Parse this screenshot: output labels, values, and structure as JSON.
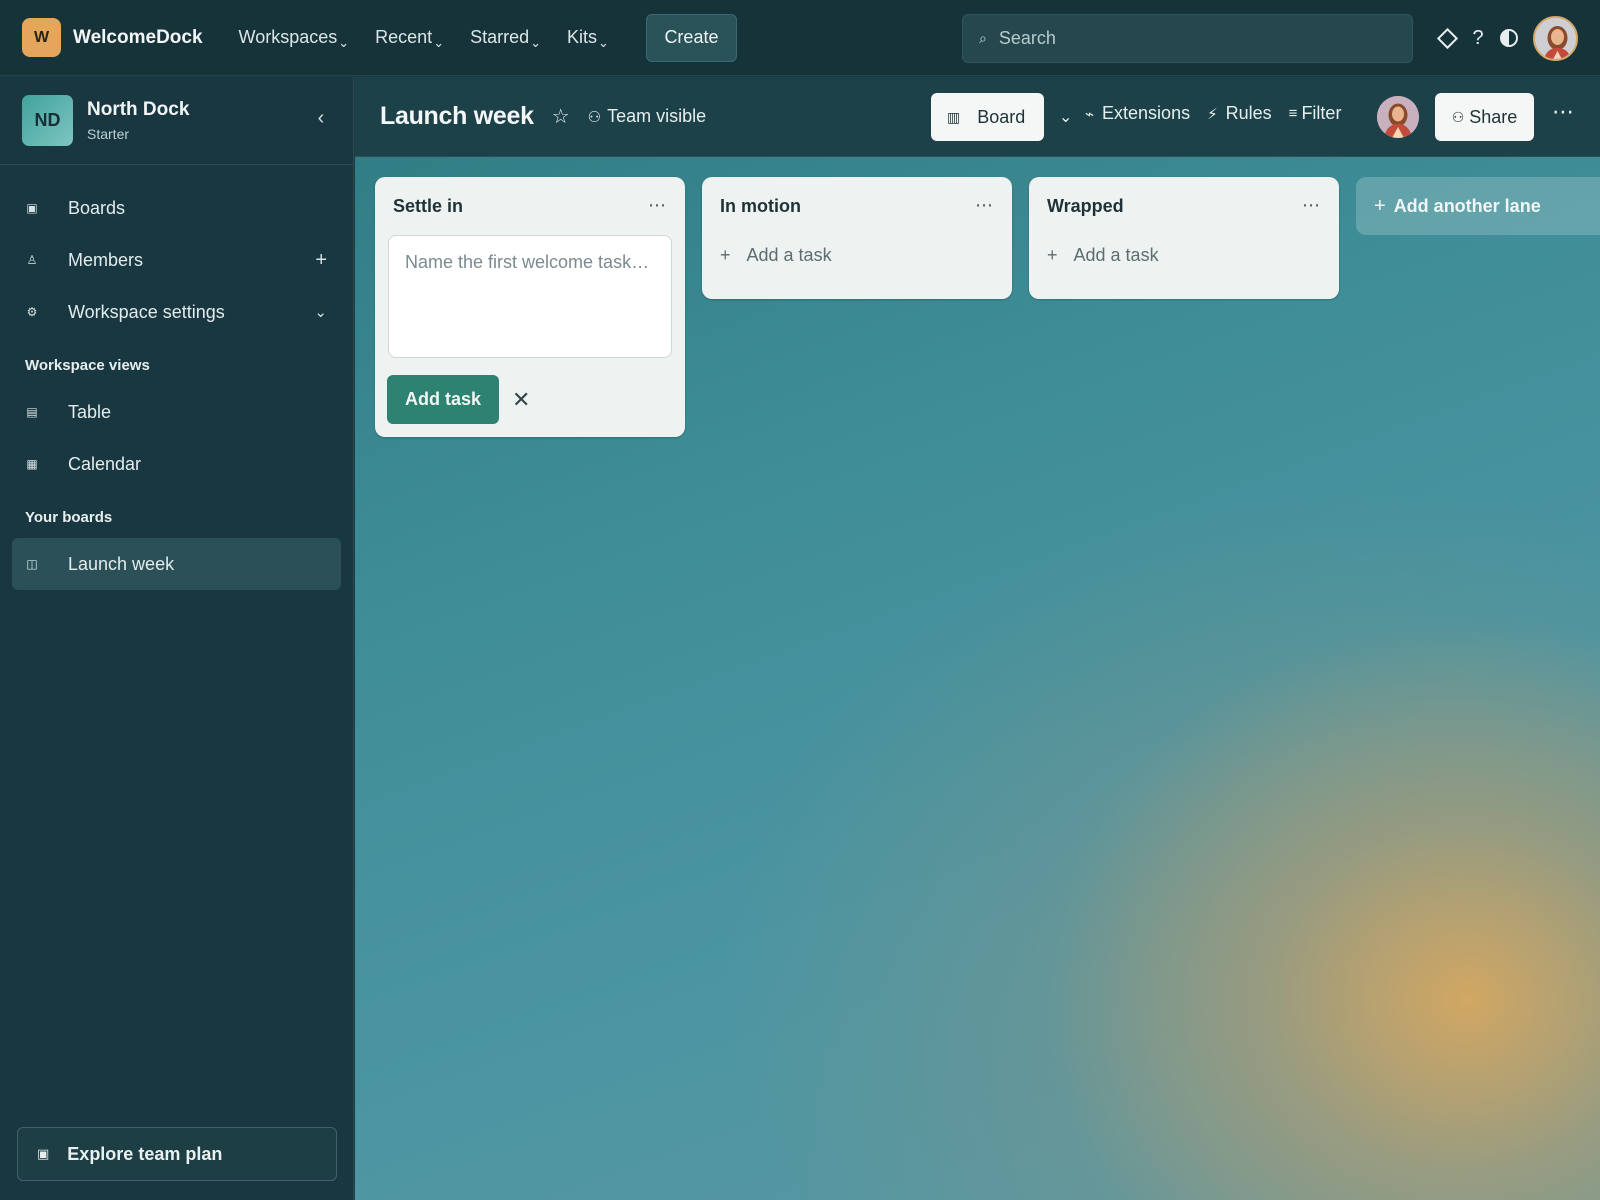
{
  "brand": {
    "logo_letter": "W",
    "name": "WelcomeDock",
    "logo_color": "#e3a65b"
  },
  "topnav": {
    "items": [
      {
        "label": "Workspaces"
      },
      {
        "label": "Recent"
      },
      {
        "label": "Starred"
      },
      {
        "label": "Kits"
      }
    ],
    "chevron": "⌄",
    "create_label": "Create"
  },
  "search": {
    "placeholder": "Search",
    "value": ""
  },
  "top_icons": [
    "diamond-icon",
    "help-icon",
    "contrast-icon",
    "avatar"
  ],
  "top_help_glyph": "?",
  "sidebar": {
    "workspace": {
      "initials": "ND",
      "name": "North Dock",
      "plan": "Starter"
    },
    "collapse_glyph": "‹",
    "items": [
      {
        "label": "Boards",
        "icon": "▣"
      },
      {
        "label": "Members",
        "icon": "♙",
        "action": "+"
      },
      {
        "label": "Workspace settings",
        "icon": "⚙",
        "action": "⌄"
      }
    ],
    "views_heading": "Workspace views",
    "views": [
      {
        "label": "Table",
        "icon": "▤"
      },
      {
        "label": "Calendar",
        "icon": "▦"
      }
    ],
    "boards_heading": "Your boards",
    "boards": [
      {
        "label": "Launch week",
        "icon": "◫"
      }
    ],
    "explore": {
      "label": "Explore team plan",
      "icon": "▣"
    }
  },
  "board": {
    "title": "Launch week",
    "star": "☆",
    "visibility_icon": "⚇",
    "visibility": "Team visible",
    "view_icon": "▥",
    "view_label": "Board",
    "view_chevron": "⌄",
    "tools": [
      {
        "icon": "⌁",
        "label": "Extensions"
      },
      {
        "icon": "⚡",
        "label": "Rules"
      },
      {
        "icon": "≡",
        "label": "Filter"
      }
    ],
    "share_icon": "⚇",
    "share_label": "Share",
    "more": "⋯"
  },
  "lanes": [
    {
      "title": "Settle in",
      "composer_placeholder": "Name the first welcome task…",
      "add_button": "Add task",
      "close": "✕"
    },
    {
      "title": "In motion",
      "add_task": "Add a task"
    },
    {
      "title": "Wrapped",
      "add_task": "Add a task"
    }
  ],
  "lane_menu": "⋯",
  "lane_plus": "+",
  "add_lane": {
    "icon": "+",
    "label": "Add another lane"
  },
  "colors": {
    "topbar": "#17333a",
    "sidebar": "#193740",
    "accent_green": "#2e8271",
    "lane_bg": "#eef3f1"
  }
}
